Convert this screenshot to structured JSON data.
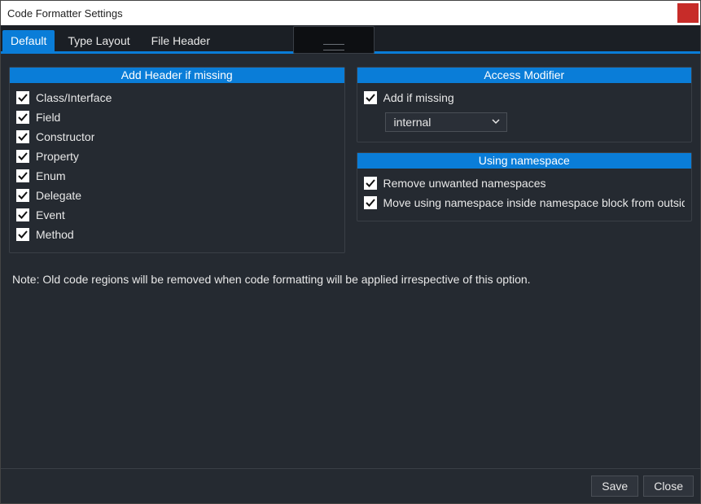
{
  "window": {
    "title": "Code Formatter Settings"
  },
  "tabs": [
    {
      "label": "Default",
      "active": true
    },
    {
      "label": "Type Layout",
      "active": false
    },
    {
      "label": "File Header",
      "active": false
    }
  ],
  "panels": {
    "addHeader": {
      "title": "Add Header if missing",
      "items": [
        {
          "label": "Class/Interface",
          "checked": true
        },
        {
          "label": "Field",
          "checked": true
        },
        {
          "label": "Constructor",
          "checked": true
        },
        {
          "label": "Property",
          "checked": true
        },
        {
          "label": "Enum",
          "checked": true
        },
        {
          "label": "Delegate",
          "checked": true
        },
        {
          "label": "Event",
          "checked": true
        },
        {
          "label": "Method",
          "checked": true
        }
      ]
    },
    "accessModifier": {
      "title": "Access Modifier",
      "addIfMissing": {
        "label": "Add if missing",
        "checked": true
      },
      "selected": "internal"
    },
    "usingNamespace": {
      "title": "Using namespace",
      "items": [
        {
          "label": "Remove unwanted namespaces",
          "checked": true
        },
        {
          "label": "Move using namespace inside namespace block from outside",
          "checked": true
        }
      ]
    }
  },
  "note": "Note: Old code regions will be removed when code formatting will be applied irrespective of this option.",
  "buttons": {
    "save": "Save",
    "close": "Close"
  }
}
